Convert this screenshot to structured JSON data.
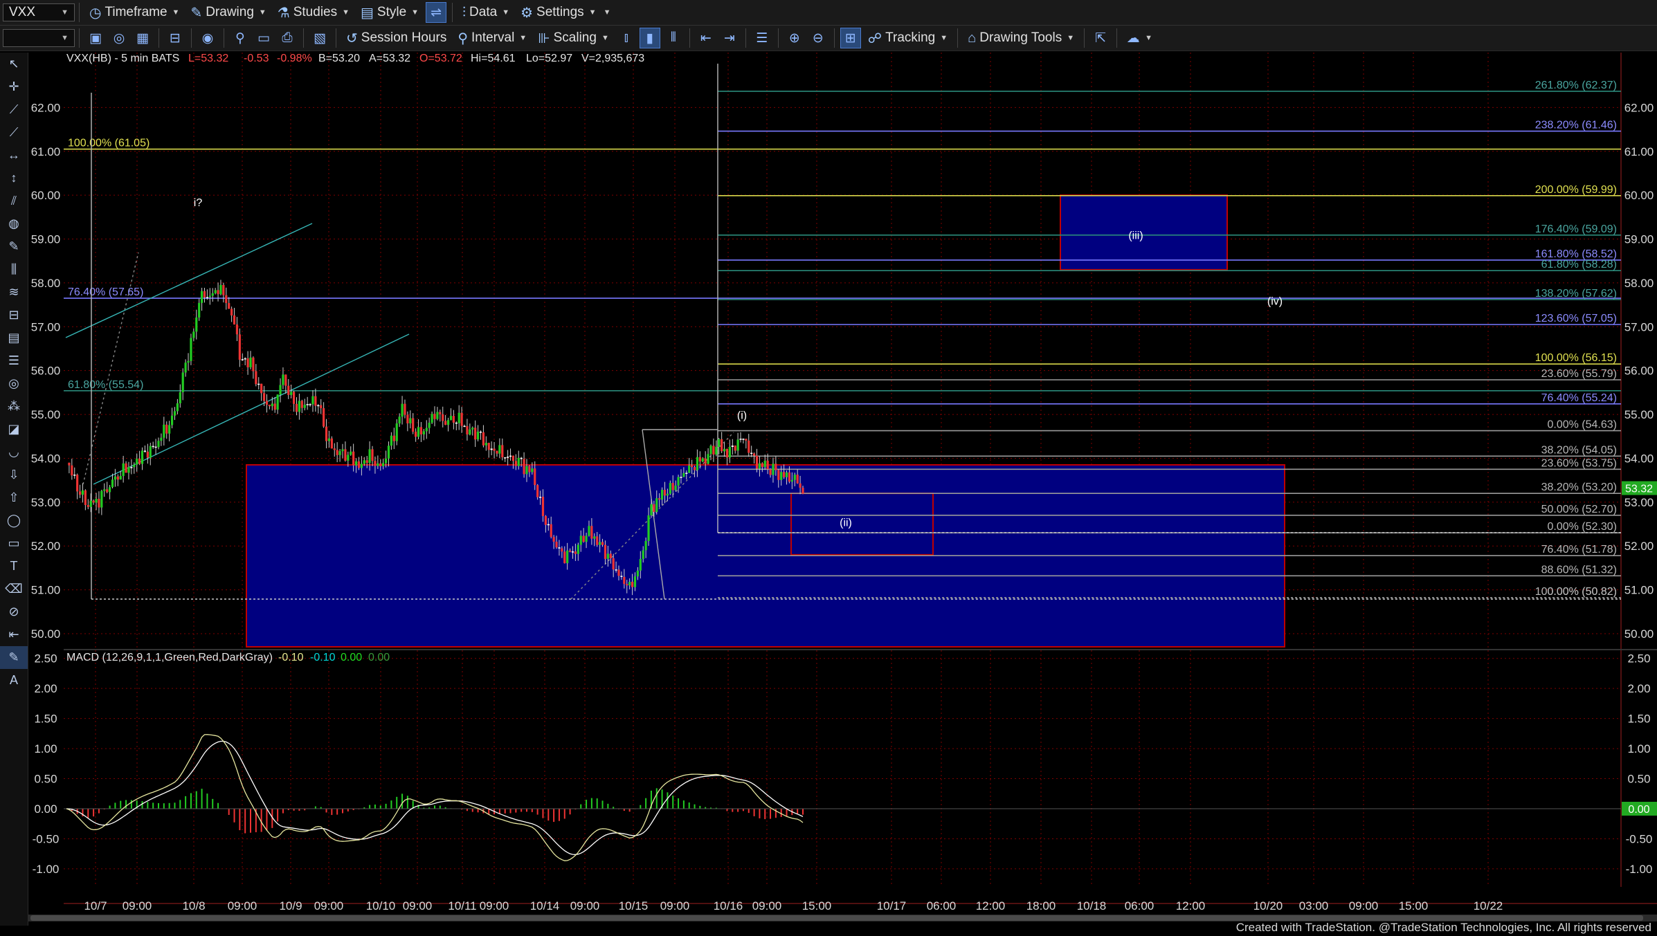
{
  "toolbar": {
    "symbol": "VXX",
    "secondary_combo": "",
    "timeframe": "Timeframe",
    "drawing": "Drawing",
    "studies": "Studies",
    "style": "Style",
    "data": "Data",
    "settings": "Settings",
    "session_hours": "Session Hours",
    "interval": "Interval",
    "scaling": "Scaling",
    "tracking": "Tracking",
    "drawing_tools": "Drawing Tools"
  },
  "footer": "Created with TradeStation. @TradeStation Technologies, Inc. All rights reserved",
  "colors": {
    "background": "#000000",
    "grid": "#800000",
    "box_blue": "#000080",
    "box_border_red": "#c00000",
    "fib_yellow": "#d8d84a",
    "fib_blue": "#7878ff",
    "fib_teal": "#2a8a7a",
    "fib_gray": "#9a9a9a",
    "bull": "#22cc22",
    "bear": "#ee3333",
    "macd_line": "#e8e8a0",
    "signal_line": "#ffffff"
  },
  "chart_data": {
    "type": "candlestick",
    "symbol_line": {
      "symbol": "VXX(HB) - 5 min BATS",
      "last": "L=53.32",
      "change": "-0.53",
      "change_pct": "-0.98%",
      "bid": "B=53.20",
      "ask": "A=53.32",
      "open": "O=53.72",
      "high": "Hi=54.61",
      "low": "Lo=52.97",
      "volume": "V=2,935,673"
    },
    "y_range": [
      49.7,
      63.0
    ],
    "y_ticks": [
      "62.00",
      "61.00",
      "60.00",
      "59.00",
      "58.00",
      "57.00",
      "56.00",
      "55.00",
      "54.00",
      "53.00",
      "52.00",
      "51.00",
      "50.00"
    ],
    "x_ticks": [
      "10/7",
      "09:00",
      "10/8",
      "09:00",
      "10/9",
      "09:00",
      "10/10",
      "09:00",
      "10/11",
      "09:00",
      "10/14",
      "09:00",
      "10/15",
      "09:00",
      "10/16",
      "09:00",
      "15:00",
      "10/17",
      "06:00",
      "12:00",
      "18:00",
      "10/18",
      "06:00",
      "12:00",
      "10/20",
      "03:00",
      "09:00",
      "15:00",
      "10/22"
    ],
    "price_path": [
      [
        0,
        53.9
      ],
      [
        2,
        53.3
      ],
      [
        4,
        52.85
      ],
      [
        6,
        53.05
      ],
      [
        8,
        53.4
      ],
      [
        10,
        53.7
      ],
      [
        12,
        53.9
      ],
      [
        14,
        54.1
      ],
      [
        16,
        54.3
      ],
      [
        18,
        54.6
      ],
      [
        20,
        55.0
      ],
      [
        22,
        56.1
      ],
      [
        24,
        57.1
      ],
      [
        25,
        57.8
      ],
      [
        26,
        57.5
      ],
      [
        28,
        57.9
      ],
      [
        30,
        57.5
      ],
      [
        31,
        57.0
      ],
      [
        32,
        56.4
      ],
      [
        34,
        56.2
      ],
      [
        36,
        55.5
      ],
      [
        38,
        55.1
      ],
      [
        40,
        55.8
      ],
      [
        42,
        55.2
      ],
      [
        44,
        55.1
      ],
      [
        46,
        55.3
      ],
      [
        47,
        55.0
      ],
      [
        48,
        54.3
      ],
      [
        50,
        54.2
      ],
      [
        52,
        54.1
      ],
      [
        54,
        53.9
      ],
      [
        56,
        54.1
      ],
      [
        58,
        53.8
      ],
      [
        60,
        54.4
      ],
      [
        62,
        55.1
      ],
      [
        64,
        54.6
      ],
      [
        66,
        54.5
      ],
      [
        68,
        55.0
      ],
      [
        70,
        54.8
      ],
      [
        72,
        54.9
      ],
      [
        74,
        54.7
      ],
      [
        76,
        54.6
      ],
      [
        78,
        54.3
      ],
      [
        80,
        54.2
      ],
      [
        82,
        54.0
      ],
      [
        84,
        53.9
      ],
      [
        86,
        53.6
      ],
      [
        88,
        52.7
      ],
      [
        90,
        52.0
      ],
      [
        92,
        51.7
      ],
      [
        94,
        51.9
      ],
      [
        96,
        52.3
      ],
      [
        98,
        52.2
      ],
      [
        100,
        51.8
      ],
      [
        102,
        51.4
      ],
      [
        104,
        51.1
      ],
      [
        106,
        51.6
      ],
      [
        108,
        52.9
      ],
      [
        110,
        53.1
      ],
      [
        112,
        53.3
      ],
      [
        114,
        53.6
      ],
      [
        116,
        53.8
      ],
      [
        118,
        54.0
      ],
      [
        120,
        54.3
      ],
      [
        122,
        54.2
      ],
      [
        124,
        54.4
      ],
      [
        125,
        54.55
      ],
      [
        127,
        54.0
      ],
      [
        129,
        53.8
      ],
      [
        131,
        53.7
      ],
      [
        133,
        53.5
      ],
      [
        135,
        53.45
      ],
      [
        136,
        53.1
      ]
    ],
    "fib_levels": [
      {
        "label": "261.80% (62.37)",
        "value": 62.37,
        "color": "teal",
        "side": "right"
      },
      {
        "label": "238.20% (61.46)",
        "value": 61.46,
        "color": "blue",
        "side": "right"
      },
      {
        "label": "100.00% (61.05)",
        "value": 61.05,
        "color": "yellow",
        "side": "left"
      },
      {
        "label": "200.00% (59.99)",
        "value": 59.99,
        "color": "yellow",
        "side": "right"
      },
      {
        "label": "176.40% (59.09)",
        "value": 59.09,
        "color": "teal",
        "side": "right"
      },
      {
        "label": "161.80% (58.52)",
        "value": 58.52,
        "color": "blue",
        "side": "right"
      },
      {
        "label": "61.80% (58.28)",
        "value": 58.28,
        "color": "teal",
        "side": "right"
      },
      {
        "label": "76.40% (57.65)",
        "value": 57.65,
        "color": "blue",
        "side": "left"
      },
      {
        "label": "138.20% (57.62)",
        "value": 57.62,
        "color": "teal",
        "side": "right"
      },
      {
        "label": "123.60% (57.05)",
        "value": 57.05,
        "color": "blue",
        "side": "right"
      },
      {
        "label": "100.00% (56.15)",
        "value": 56.15,
        "color": "yellow",
        "side": "right"
      },
      {
        "label": "23.60% (55.79)",
        "value": 55.79,
        "color": "gray",
        "side": "right"
      },
      {
        "label": "61.80% (55.54)",
        "value": 55.54,
        "color": "teal",
        "side": "left"
      },
      {
        "label": "76.40% (55.24)",
        "value": 55.24,
        "color": "blue",
        "side": "right"
      },
      {
        "label": "0.00% (54.63)",
        "value": 54.63,
        "color": "gray",
        "side": "right"
      },
      {
        "label": "38.20% (54.05)",
        "value": 54.05,
        "color": "gray",
        "side": "right"
      },
      {
        "label": "23.60% (53.75)",
        "value": 53.75,
        "color": "gray",
        "side": "right"
      },
      {
        "label": "38.20% (53.20)",
        "value": 53.2,
        "color": "gray",
        "side": "right"
      },
      {
        "label": "50.00% (52.70)",
        "value": 52.7,
        "color": "gray",
        "side": "right"
      },
      {
        "label": "0.00% (52.30)",
        "value": 52.3,
        "color": "gray",
        "side": "right"
      },
      {
        "label": "76.40% (51.78)",
        "value": 51.78,
        "color": "gray",
        "side": "right"
      },
      {
        "label": "88.60% (51.32)",
        "value": 51.32,
        "color": "gray",
        "side": "right"
      },
      {
        "label": "100.00% (50.82)",
        "value": 50.82,
        "color": "gray",
        "side": "right"
      },
      {
        "label": "0.00% (50.82)",
        "value": 50.82,
        "color": "gray",
        "side": "right"
      }
    ],
    "wave_labels": [
      {
        "text": "i?",
        "price": 59.75
      },
      {
        "text": "(i)",
        "price": 54.9
      },
      {
        "text": "(ii)",
        "price": 52.45
      },
      {
        "text": "(iii)",
        "price": 59.0
      },
      {
        "text": "(iv)",
        "price": 57.5
      }
    ],
    "boxes": [
      {
        "name": "support-box",
        "top": 53.85,
        "bottom": 49.7
      },
      {
        "name": "wave-ii-box",
        "top": 53.2,
        "bottom": 51.8
      },
      {
        "name": "wave-iii-box",
        "top": 60.0,
        "bottom": 58.3
      }
    ],
    "last_price_tag": "53.32",
    "macd": {
      "label": "MACD (12,26,9,1,1,Green,Red,DarkGray)",
      "macd_value": "-0.10",
      "signal_value": "-0.10",
      "hist_value": "0.00",
      "zero_value": "0.00",
      "last_tag": "0.00",
      "y_range": [
        -1.3,
        2.6
      ],
      "y_ticks": [
        "2.50",
        "2.00",
        "1.50",
        "1.00",
        "0.50",
        "0.00",
        "-0.50",
        "-1.00"
      ]
    }
  }
}
